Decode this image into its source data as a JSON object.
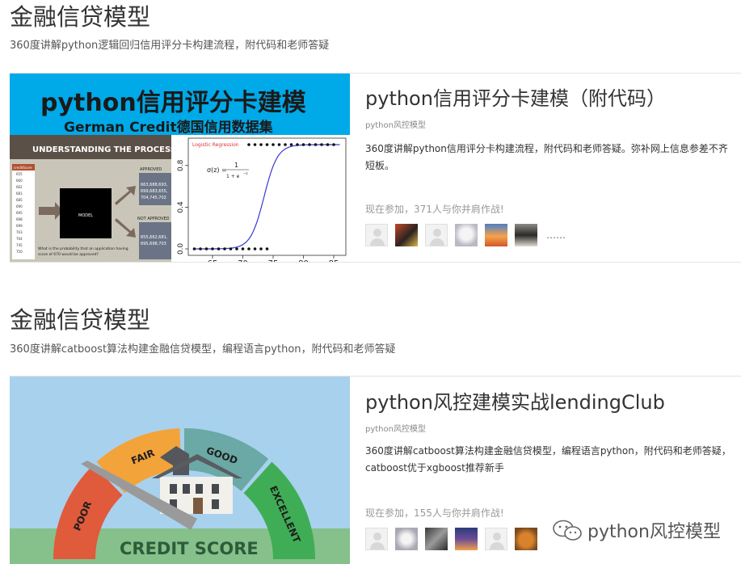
{
  "sections": [
    {
      "title": "金融信贷模型",
      "subtitle": "360度讲解python逻辑回归信用评分卡构建流程，附代码和老师答疑",
      "card": {
        "thumb": {
          "title_line1": "python信用评分卡建模",
          "title_line2": "German Credit德国信用数据集",
          "banner": "UNDERSTANDING THE PROCESS",
          "model_label": "MODEL",
          "approved_label": "APPROVED",
          "approved_values": "663,688,693,\n699,683,655,\n704,745,702",
          "not_approved_label": "NOT APPROVED",
          "not_approved_values": "655,662,681,\n695,698,703",
          "question": "What is the probability that an application having score of 670 would be approved?",
          "score_list_header": "creditScore",
          "scores": [
            "655",
            "660",
            "662",
            "681",
            "685",
            "690",
            "695",
            "698",
            "699",
            "703",
            "704",
            "745",
            "750"
          ],
          "plot_title": "Logistic Regression",
          "formula": "σ(z) = 1 / (1 + e^-z)",
          "x_ticks": [
            "65",
            "70",
            "75",
            "80",
            "85"
          ],
          "y_ticks": [
            "0.0",
            "0.4",
            "0.8"
          ]
        },
        "title": "python信用评分卡建模（附代码）",
        "tag": "python风控模型",
        "description": "360度讲解python信用评分卡构建流程，附代码和老师答疑。弥补网上信息参差不齐短板。",
        "participants": "现在参加，371人与你并肩作战!",
        "more": "……"
      }
    },
    {
      "title": "金融信贷模型",
      "subtitle": "360度讲解catboost算法构建金融信贷模型，编程语言python，附代码和老师答疑",
      "card": {
        "thumb": {
          "gauge_labels": [
            "POOR",
            "FAIR",
            "GOOD",
            "EXCELLENT"
          ],
          "caption": "CREDIT SCORE"
        },
        "title": "python风控建模实战lendingClub",
        "tag": "python风控模型",
        "description": "360度讲解catboost算法构建金融信贷模型，编程语言python，附代码和老师答疑，catboost优于xgboost推荐新手",
        "participants": "现在参加，155人与你并肩作战!"
      }
    }
  ],
  "watermark": "python风控模型",
  "colors": {
    "accent_blue": "#00a9e8",
    "text": "#333333",
    "muted": "#999999"
  }
}
